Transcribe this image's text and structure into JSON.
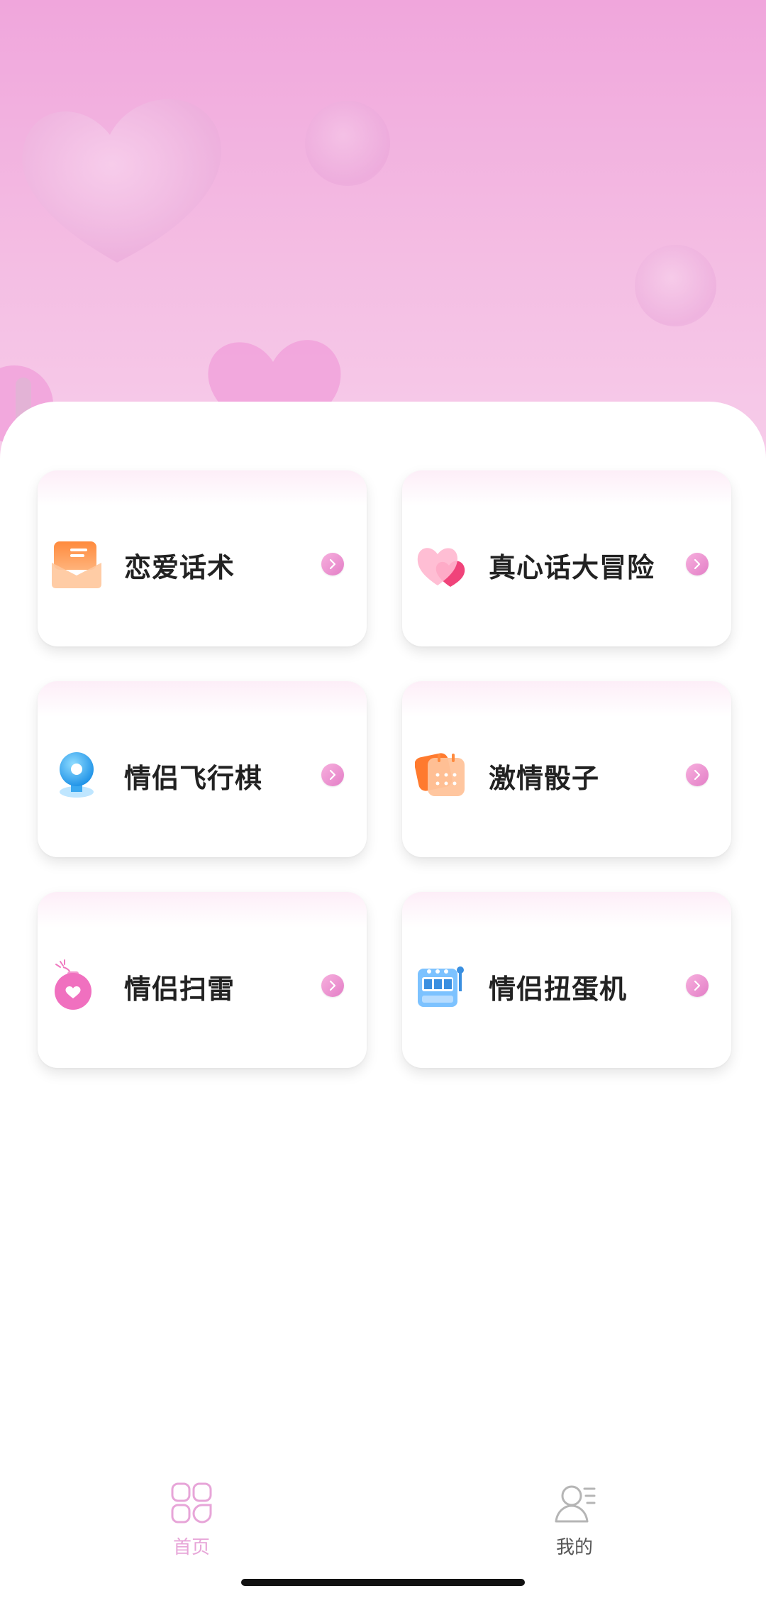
{
  "colors": {
    "hero_top": "#f0a6dc",
    "hero_bottom": "#f7cdea",
    "accent_pink": "#e88ac9",
    "tab_active": "#e7a5d8",
    "tab_inactive": "#555555",
    "label_text": "#222222"
  },
  "games": [
    {
      "label": "恋爱话术",
      "icon": "love-letter-icon"
    },
    {
      "label": "真心话大冒险",
      "icon": "hearts-icon"
    },
    {
      "label": "情侣飞行棋",
      "icon": "game-piece-icon"
    },
    {
      "label": "激情骰子",
      "icon": "dice-icon"
    },
    {
      "label": "情侣扫雷",
      "icon": "love-bomb-icon"
    },
    {
      "label": "情侣扭蛋机",
      "icon": "slot-machine-icon"
    }
  ],
  "tabbar": {
    "home": {
      "label": "首页",
      "icon": "grid-icon",
      "active": true
    },
    "mine": {
      "label": "我的",
      "icon": "user-profile-icon",
      "active": false
    }
  }
}
